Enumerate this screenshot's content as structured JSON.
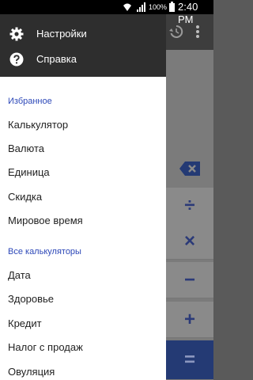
{
  "status_bar": {
    "battery_percent": "100%",
    "time": "2:40 PM"
  },
  "drawer": {
    "header_items": [
      {
        "label": "Настройки",
        "icon": "gear-icon"
      },
      {
        "label": "Справка",
        "icon": "help-icon"
      }
    ],
    "favorites": {
      "title": "Избранное",
      "items": [
        "Калькулятор",
        "Валюта",
        "Единица",
        "Скидка",
        "Мировое время"
      ]
    },
    "all_calculators": {
      "title": "Все калькуляторы",
      "items": [
        "Дата",
        "Здоровье",
        "Кредит",
        "Налог с продаж",
        "Овуляция"
      ]
    }
  },
  "app": {
    "keys": {
      "divide": "÷",
      "multiply": "×",
      "minus": "−",
      "plus": "+",
      "equals": "="
    },
    "accent_color": "#2d48b8"
  }
}
